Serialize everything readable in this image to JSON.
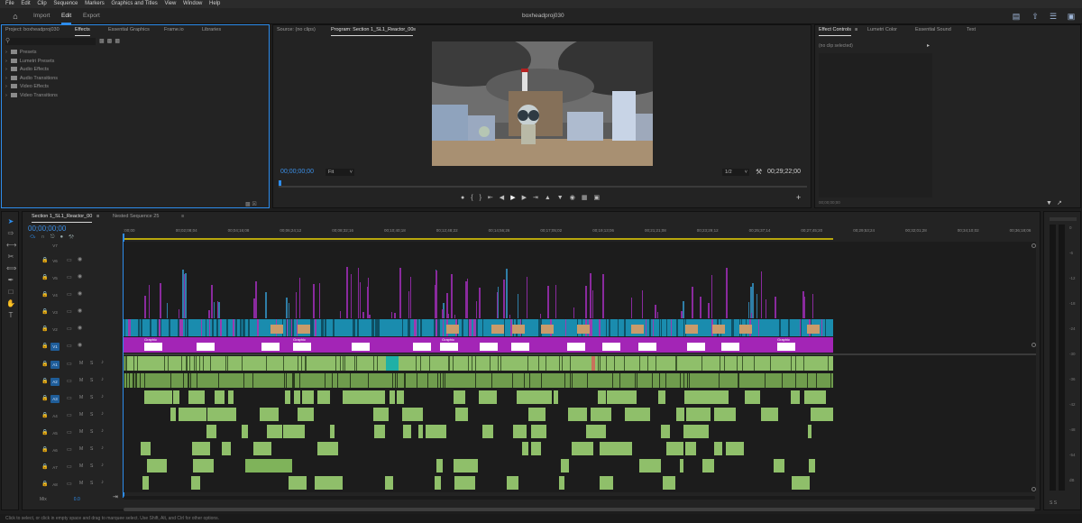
{
  "menu": [
    "File",
    "Edit",
    "Clip",
    "Sequence",
    "Markers",
    "Graphics and Titles",
    "View",
    "Window",
    "Help"
  ],
  "workspace_tabs": [
    {
      "label": "Import"
    },
    {
      "label": "Edit"
    },
    {
      "label": "Export"
    }
  ],
  "project_name": "boxheadproj030",
  "left_panel": {
    "tabs": [
      "Project: boxheadproj030",
      "Effects",
      "Essential Graphics",
      "Frame.io",
      "Libraries"
    ],
    "search_icon": "search-icon",
    "tree": [
      "Presets",
      "Lumetri Presets",
      "Audio Effects",
      "Audio Transitions",
      "Video Effects",
      "Video Transitions"
    ]
  },
  "program": {
    "source_tab": "Source: (no clips)",
    "program_tab": "Program: Section 1_SL1_Reactor_00",
    "timecode_left": "00;00;00;00",
    "fit": "Fit",
    "quality": "1/2",
    "timecode_right": "00;29;22;00"
  },
  "right_panel": {
    "tabs": [
      "Effect Controls",
      "Lumetri Color",
      "Essential Sound",
      "Text"
    ],
    "no_clip": "(no clip selected)",
    "timecode": "00;00;00;00"
  },
  "timeline": {
    "tabs": [
      "Section 1_SL1_Reactor_00",
      "Nested Sequence 25"
    ],
    "timecode": "00;00;00;00",
    "ruler": [
      ":00;00",
      "00;02;08;04",
      "00;04;16;08",
      "00;06;24;12",
      "00;08;32;16",
      "00;10;40;18",
      "00;12;48;22",
      "00;14;56;26",
      "00;17;05;02",
      "00;19;13;06",
      "00;21;21;08",
      "00;23;29;12",
      "00;25;37;14",
      "00;27;45;20",
      "00;29;53;24",
      "00;32;01;28",
      "00;34;10;02",
      "00;36;18;06"
    ],
    "video_tracks": [
      "V7",
      "V6",
      "V5",
      "V4",
      "V3",
      "V2",
      "V1"
    ],
    "audio_tracks": [
      "A1",
      "A2",
      "A3",
      "A4",
      "A5",
      "A6",
      "A7",
      "A8"
    ],
    "mix": {
      "label": "Mix",
      "value": "0.0"
    },
    "title_label": "Graphic"
  },
  "meter": {
    "labels": [
      "0",
      "-6",
      "-12",
      "-18",
      "-24",
      "-30",
      "-36",
      "-42",
      "-48",
      "-54",
      "dB"
    ],
    "bottom": "S S"
  },
  "status": "Click to select, or click in empty space and drag to marquee select. Use Shift, Alt, and Ctrl for other options.",
  "colors": {
    "accent": "#2d8ceb",
    "video_clip": "#1a8cae",
    "title_clip": "#a325b6",
    "audio_clip": "#8fbf6a",
    "playhead": "#2d8ceb"
  }
}
